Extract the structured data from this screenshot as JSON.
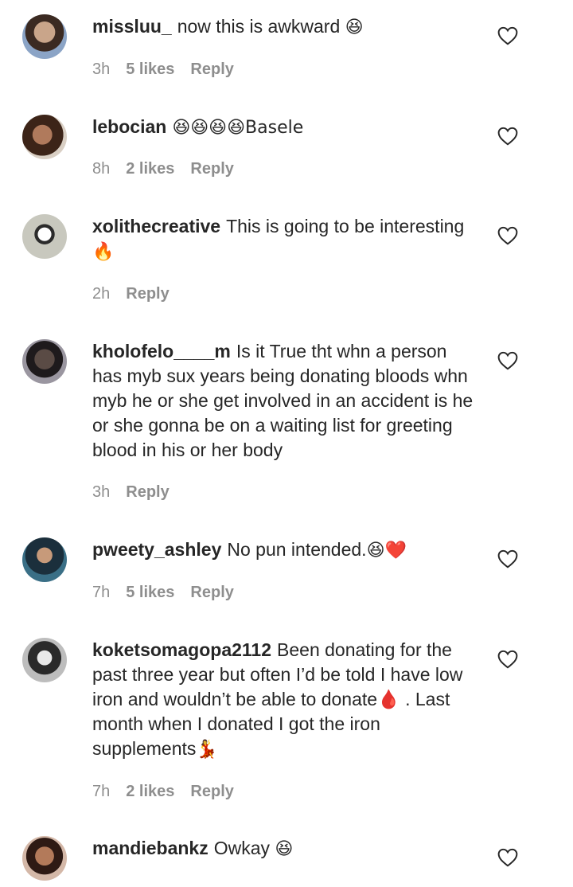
{
  "comments": [
    {
      "username": "missluu_",
      "text": "now this is awkward",
      "emoji": "😆",
      "time": "3h",
      "likes": "5 likes",
      "reply": "Reply",
      "avatar_color": "#6b4e3d"
    },
    {
      "username": "lebocian",
      "text": "😆😆😆😆Basele",
      "emoji": "",
      "time": "8h",
      "likes": "2 likes",
      "reply": "Reply",
      "avatar_color": "#5a3a2a"
    },
    {
      "username": "xolithecreative",
      "text": "This is going to be interesting",
      "emoji": "🔥",
      "time": "2h",
      "likes": "",
      "reply": "Reply",
      "avatar_color": "#9a9a8e"
    },
    {
      "username": "kholofelo____m",
      "text": "Is it True tht whn a person has myb sux years being donating bloods whn myb he or she get involved in an accident is he or she gonna be on a waiting list for greeting blood in his or her body",
      "emoji": "",
      "time": "3h",
      "likes": "",
      "reply": "Reply",
      "avatar_color": "#6e6a72"
    },
    {
      "username": "pweety_ashley",
      "text": "No pun intended.",
      "emoji": "😆❤️",
      "time": "7h",
      "likes": "5 likes",
      "reply": "Reply",
      "avatar_color": "#1f3b4a"
    },
    {
      "username": "koketsomagopa2112",
      "text": "Been donating for the past three year but often I’d be told I have low iron and wouldn’t be able to donate🩸 . Last month when I donated I got the iron supplements",
      "emoji": "💃",
      "time": "7h",
      "likes": "2 likes",
      "reply": "Reply",
      "avatar_color": "#3a3a3a"
    },
    {
      "username": "mandiebankz",
      "text": "Owkay",
      "emoji": "😆",
      "time": "",
      "likes": "",
      "reply": "",
      "avatar_color": "#4a2e25"
    }
  ],
  "icons": {
    "like": "heart-outline-icon"
  }
}
